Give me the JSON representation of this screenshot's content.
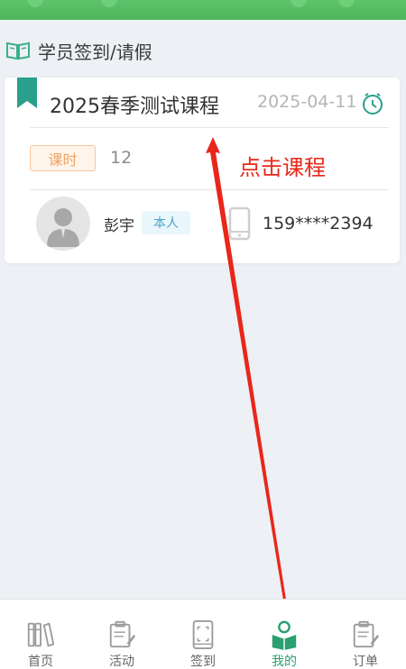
{
  "section": {
    "title": "学员签到/请假"
  },
  "course": {
    "title": "2025春季测试课程",
    "date": "2025-04-11",
    "hours_label": "课时",
    "hours_value": "12"
  },
  "student": {
    "name": "彭宇",
    "self_badge": "本人",
    "phone": "159****2394"
  },
  "annotation": {
    "text": "点击课程"
  },
  "nav": {
    "items": [
      {
        "label": "首页",
        "icon": "books-icon"
      },
      {
        "label": "活动",
        "icon": "notepad-icon"
      },
      {
        "label": "签到",
        "icon": "scan-icon"
      },
      {
        "label": "我的",
        "icon": "reader-icon"
      },
      {
        "label": "订单",
        "icon": "order-icon"
      }
    ],
    "active_index": 3
  },
  "colors": {
    "brand_green": "#2a9f6f",
    "accent_orange": "#f0a466",
    "annotation_red": "#e8271a"
  }
}
